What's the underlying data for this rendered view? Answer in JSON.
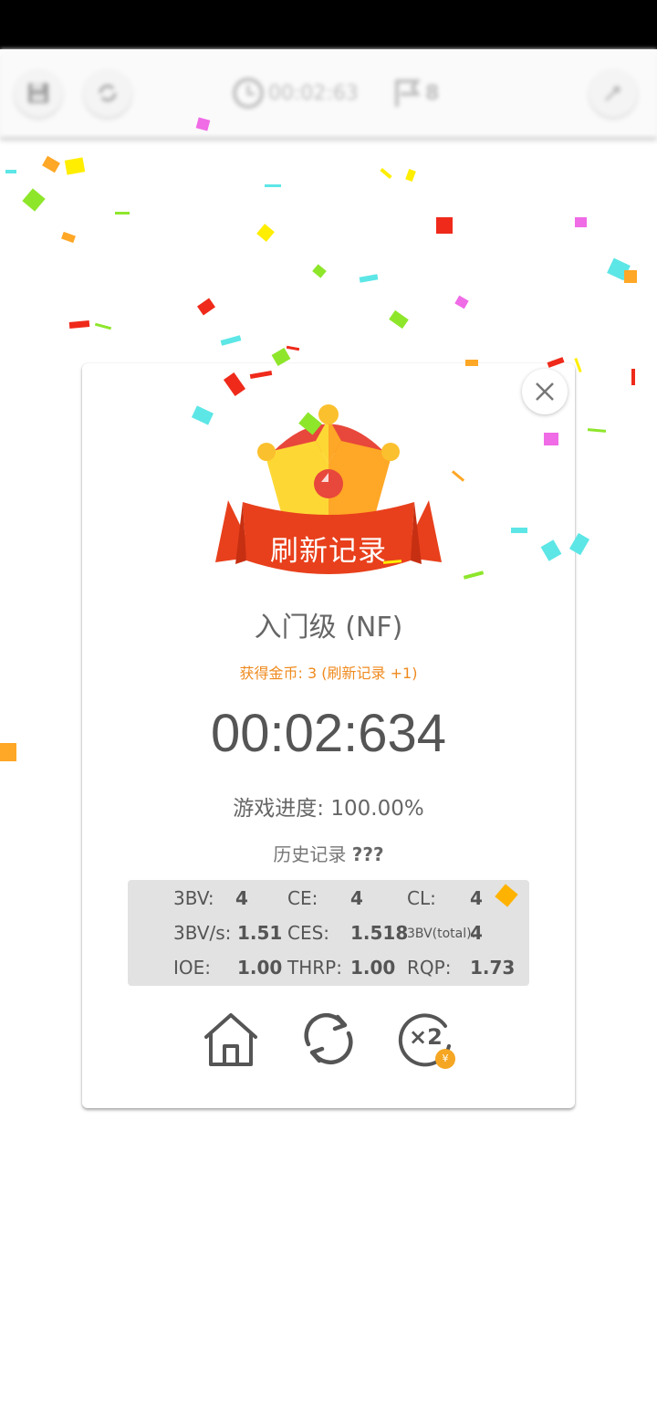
{
  "toolbar": {
    "timer_text": "00:02:63",
    "flags_count": "8",
    "icons": [
      "save-icon",
      "restart-icon",
      "clock-icon",
      "flag-icon",
      "settings-icon"
    ]
  },
  "dialog": {
    "banner_text": "刷新记录",
    "level": "入门级 (NF)",
    "coins_text": "获得金币: 3 (刷新记录 +1)",
    "time": "00:02:634",
    "progress_label": "游戏进度:",
    "progress_value": "100.00%",
    "history_label": "历史记录",
    "history_value": "???"
  },
  "stats": {
    "row1": [
      {
        "label": "3BV:",
        "value": "4"
      },
      {
        "label": "CE:",
        "value": "4"
      },
      {
        "label": "CL:",
        "value": "4"
      }
    ],
    "row2": [
      {
        "label": "3BV/s:",
        "value": "1.51"
      },
      {
        "label": "CES:",
        "value": "1.518"
      },
      {
        "label": "3BV(total):",
        "value": "4"
      }
    ],
    "row3": [
      {
        "label": "IOE:",
        "value": "1.00"
      },
      {
        "label": "THRP:",
        "value": "1.00"
      },
      {
        "label": "RQP:",
        "value": "1.73"
      }
    ]
  },
  "actions": {
    "double_label": "×2",
    "coin_symbol": "¥"
  },
  "colors": {
    "accent_orange": "#ef8a1e",
    "ribbon_red": "#e8401c",
    "crown_yellow": "#fdd835",
    "crown_orange": "#ffa726"
  }
}
